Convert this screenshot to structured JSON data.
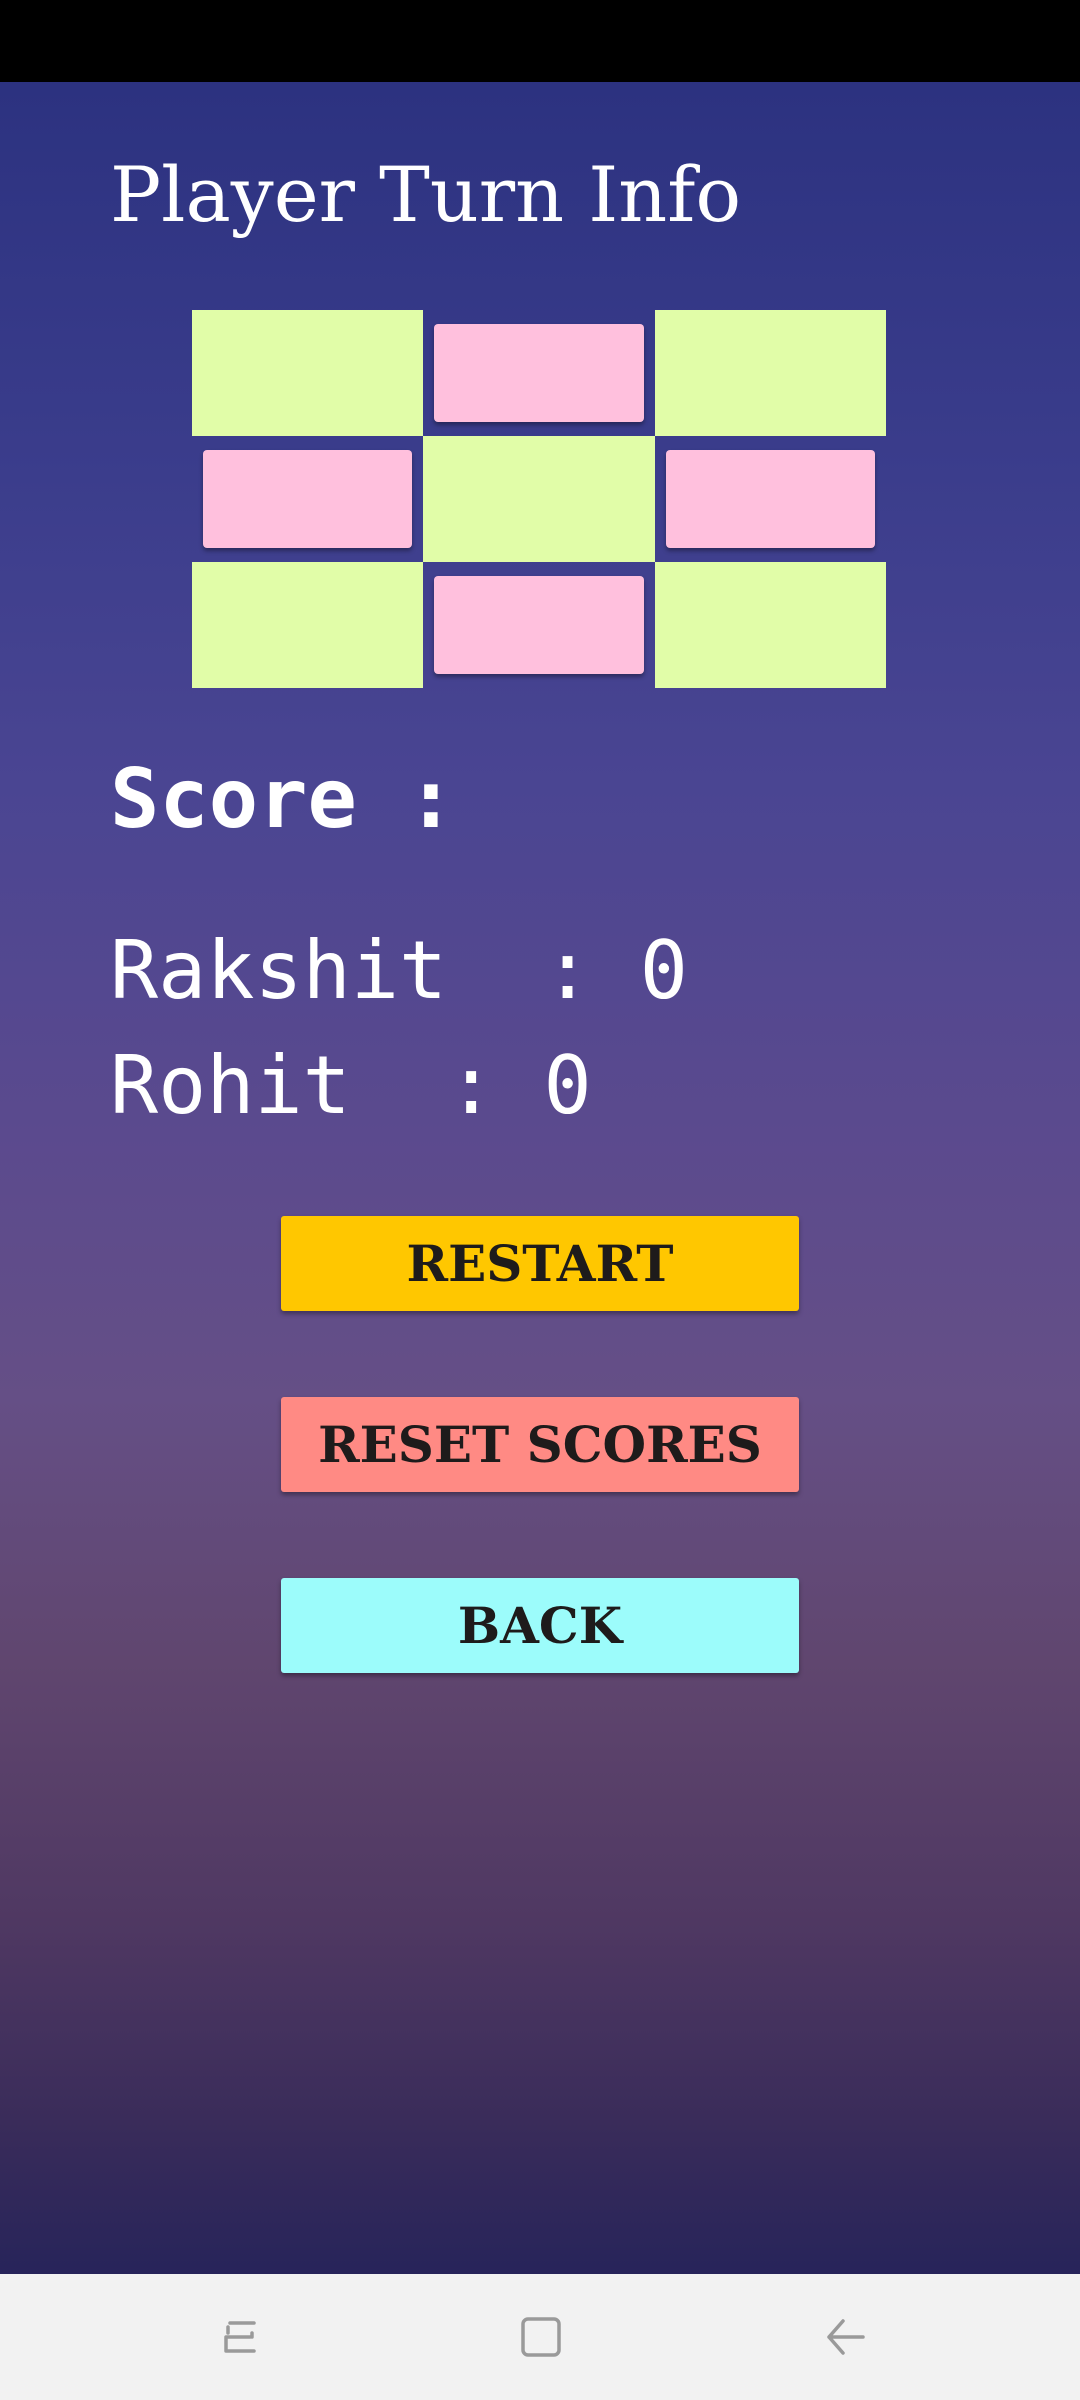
{
  "app": {
    "title": "Player Turn Info"
  },
  "board": {
    "cells": [
      {
        "index": 0,
        "color": "#e1fda8",
        "kind": "green"
      },
      {
        "index": 1,
        "color": "#ffc0dd",
        "kind": "pink"
      },
      {
        "index": 2,
        "color": "#e1fda8",
        "kind": "green"
      },
      {
        "index": 3,
        "color": "#ffc0dd",
        "kind": "pink"
      },
      {
        "index": 4,
        "color": "#e1fda8",
        "kind": "green"
      },
      {
        "index": 5,
        "color": "#ffc0dd",
        "kind": "pink"
      },
      {
        "index": 6,
        "color": "#e1fda8",
        "kind": "green"
      },
      {
        "index": 7,
        "color": "#ffc0dd",
        "kind": "pink"
      },
      {
        "index": 8,
        "color": "#e1fda8",
        "kind": "green"
      }
    ]
  },
  "score": {
    "heading": "Score :",
    "players": [
      {
        "line": "Rakshit  : 0"
      },
      {
        "line": "Rohit  : 0"
      }
    ]
  },
  "buttons": {
    "restart_label": "RESTART",
    "reset_scores_label": "RESET SCORES",
    "back_label": "BACK",
    "restart_color": "#ffc700",
    "reset_color": "#ff8a84",
    "back_color": "#9cfcfb"
  },
  "navigation": {
    "icons": [
      "recents-icon",
      "home-icon",
      "back-icon"
    ]
  }
}
